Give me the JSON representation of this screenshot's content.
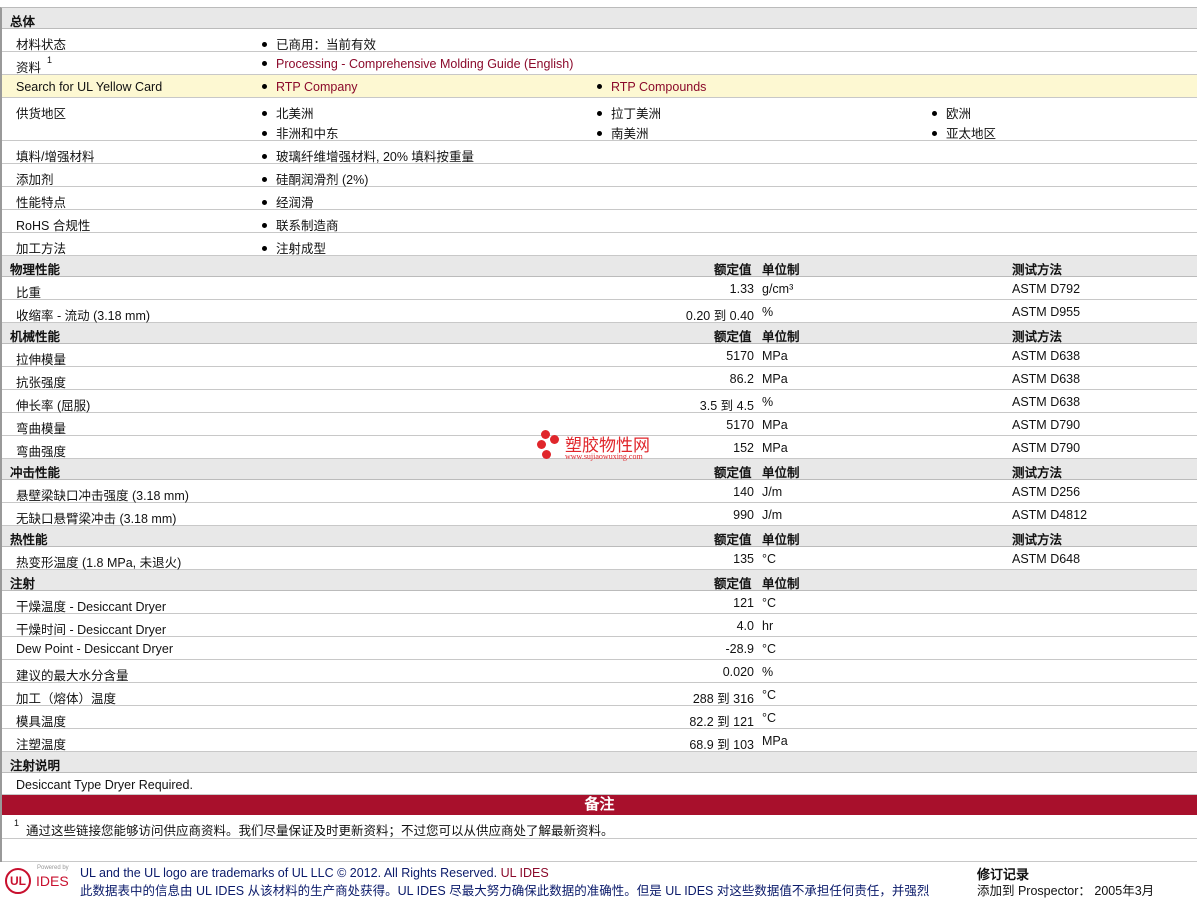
{
  "general": {
    "title": "总体",
    "rows": [
      {
        "label": "材料状态",
        "items": [
          "已商用：当前有效"
        ]
      },
      {
        "label": "资料",
        "sup": "1",
        "items": [
          "Processing - Comprehensive Molding Guide (English)"
        ]
      },
      {
        "label": "Search for UL Yellow Card",
        "items": [
          "RTP Company",
          "RTP Compounds"
        ]
      },
      {
        "label": "供货地区",
        "items": [
          "北美洲",
          "拉丁美洲",
          "欧洲",
          "非洲和中东",
          "南美洲",
          "亚太地区"
        ]
      },
      {
        "label": "填料/增强材料",
        "items": [
          "玻璃纤维增强材料, 20% 填料按重量"
        ]
      },
      {
        "label": "添加剂",
        "items": [
          "硅酮润滑剂 (2%)"
        ]
      },
      {
        "label": "性能特点",
        "items": [
          "经润滑"
        ]
      },
      {
        "label": "RoHS 合规性",
        "items": [
          "联系制造商"
        ]
      },
      {
        "label": "加工方法",
        "items": [
          "注射成型"
        ]
      }
    ]
  },
  "col_headers": {
    "value": "额定值",
    "unit": "单位制",
    "method": "测试方法"
  },
  "sections": [
    {
      "title": "物理性能",
      "method": true,
      "rows": [
        {
          "label": "比重",
          "value": "1.33",
          "unit": "g/cm³",
          "method": "ASTM D792"
        },
        {
          "label": "收缩率  - 流动  (3.18 mm)",
          "value": "0.20 到  0.40",
          "unit": "%",
          "method": "ASTM D955"
        }
      ]
    },
    {
      "title": "机械性能",
      "method": true,
      "rows": [
        {
          "label": "拉伸模量",
          "value": "5170",
          "unit": "MPa",
          "method": "ASTM D638"
        },
        {
          "label": "抗张强度",
          "value": "86.2",
          "unit": "MPa",
          "method": "ASTM D638"
        },
        {
          "label": "伸长率  (屈服)",
          "value": "3.5 到  4.5",
          "unit": "%",
          "method": "ASTM D638"
        },
        {
          "label": "弯曲模量",
          "value": "5170",
          "unit": "MPa",
          "method": "ASTM D790"
        },
        {
          "label": "弯曲强度",
          "value": "152",
          "unit": "MPa",
          "method": "ASTM D790"
        }
      ]
    },
    {
      "title": "冲击性能",
      "method": true,
      "rows": [
        {
          "label": "悬壁梁缺口冲击强度  (3.18 mm)",
          "value": "140",
          "unit": "J/m",
          "method": "ASTM D256"
        },
        {
          "label": "无缺口悬臂梁冲击  (3.18 mm)",
          "value": "990",
          "unit": "J/m",
          "method": "ASTM D4812"
        }
      ]
    },
    {
      "title": "热性能",
      "method": true,
      "rows": [
        {
          "label": "热变形温度  (1.8 MPa, 未退火)",
          "value": "135",
          "unit": "°C",
          "method": "ASTM D648"
        }
      ]
    },
    {
      "title": "注射",
      "method": false,
      "rows": [
        {
          "label": "干燥温度  - Desiccant Dryer",
          "value": "121",
          "unit": "°C"
        },
        {
          "label": "干燥时间  - Desiccant Dryer",
          "value": "4.0",
          "unit": "hr"
        },
        {
          "label": "Dew Point - Desiccant Dryer",
          "value": "-28.9",
          "unit": "°C"
        },
        {
          "label": "建议的最大水分含量",
          "value": "0.020",
          "unit": "%"
        },
        {
          "label": "加工（熔体）温度",
          "value": "288 到  316",
          "unit": "°C"
        },
        {
          "label": "模具温度",
          "value": "82.2 到  121",
          "unit": "°C"
        },
        {
          "label": "注塑温度",
          "value": "68.9 到  103",
          "unit": "MPa"
        }
      ]
    }
  ],
  "notes": {
    "title": "注射说明",
    "text": "Desiccant Type Dryer Required."
  },
  "remarks": {
    "title": "备注",
    "sup": "1",
    "text": "通过这些链接您能够访问供应商资料。我们尽量保证及时更新资料；不过您可以从供应商处了解最新资料。"
  },
  "watermark": {
    "name": "塑胶物性网",
    "url": "www.sujiaowuxing.com"
  },
  "footer": {
    "logo_small": "Powered by",
    "logo_ul": "UL",
    "logo_ides": "IDES",
    "trademark": "UL and the UL logo are trademarks of UL LLC © 2012. All Rights Reserved.",
    "ul_ides": "UL IDES",
    "disclaimer": "此数据表中的信息由 UL IDES 从该材料的生产商处获得。UL IDES 尽最大努力确保此数据的准确性。但是 UL IDES 对这些数据值不承担任何责任，并强烈",
    "rev_title": "修订记录",
    "rev_text": "添加到 Prospector： 2005年3月"
  }
}
